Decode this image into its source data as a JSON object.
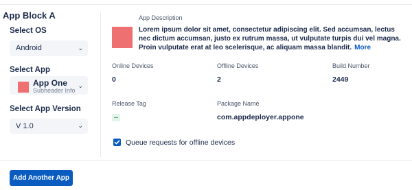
{
  "app_block": {
    "title": "App Block A",
    "os": {
      "label": "Select OS",
      "value": "Android"
    },
    "app": {
      "label": "Select App",
      "name": "App One",
      "subheader": "Subheader Info"
    },
    "version": {
      "label": "Select App Version",
      "value": "V 1.0"
    }
  },
  "details": {
    "description_label": "App Description",
    "description": "Lorem ipsum dolor sit amet, consectetur adipiscing elit. Sed accumsan, lectus nec dictum accumsan, justo ex rutrum massa, ut vulputate turpis dui vel magna. Proin vulputate erat at leo scelerisque, ac aliquam massa blandit.",
    "more_link": "More",
    "online_label": "Online Devices",
    "online_value": "0",
    "offline_label": "Offline Devices",
    "offline_value": "2",
    "build_label": "Build Number",
    "build_value": "2449",
    "release_label": "Release Tag",
    "release_value": "--",
    "package_label": "Package Name",
    "package_value": "com.appdeployer.appone",
    "queue_label": "Queue requests for offline devices",
    "queue_checked": true
  },
  "actions": {
    "add_app": "Add Another App"
  },
  "colors": {
    "accent": "#0a5cc0",
    "swatch": "#ee7070",
    "tag_bg": "#e3f4ea"
  },
  "icons": {
    "select_chevron": "chevron-down-icon",
    "checkbox": "checkmark-icon"
  }
}
